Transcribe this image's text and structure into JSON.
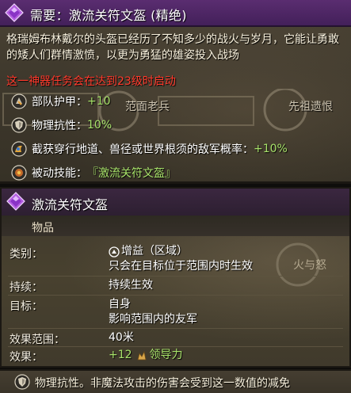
{
  "artifact": {
    "title": "需要：激流关符文盔 (精绝)",
    "description": "格瑞姆布林戴尔的头盔已经历了不知多少的战火与岁月，它能让勇敢的矮人们群情激愤，以更为勇猛的雄姿投入战场",
    "warning": "这一神器任务会在达到23级时启动",
    "stats": [
      {
        "icon": "armour-icon",
        "label": "部队护甲：",
        "value": "+10"
      },
      {
        "icon": "shield-icon",
        "label": "物理抗性：",
        "value": "10%"
      },
      {
        "icon": "ambush-icon",
        "label": "截获穿行地道、兽径或世界根须的敌军概率：",
        "value": "+10%"
      },
      {
        "icon": "passive-skill-icon",
        "label": "被动技能：",
        "value": "『激流关符文盔』"
      }
    ],
    "background_labels": [
      "范面老兵",
      "先祖遗恨"
    ]
  },
  "ability": {
    "title": "激流关符文盔",
    "subtitle": "物品",
    "rows": [
      {
        "label": "类别：",
        "values": [
          "增益（区域）",
          "只会在目标位于范围内时生效"
        ]
      },
      {
        "label": "持续：",
        "values": [
          "持续生效"
        ]
      },
      {
        "label": "目标：",
        "values": [
          "自身",
          "影响范围内的友军"
        ]
      },
      {
        "label": "效果范围：",
        "values": [
          "40米"
        ]
      },
      {
        "label": "效果：",
        "values": [
          "+12",
          "领导力"
        ]
      }
    ],
    "background_hint": "火与怒"
  },
  "footer": {
    "icon": "shield-icon",
    "text": "物理抗性。非魔法攻击的伤害会受到这一数值的减免"
  },
  "colors": {
    "title_bar": "#5a2d70",
    "stat_value": "#a8e26a",
    "warning": "#ff3a2c",
    "panel": "#3f392d"
  }
}
